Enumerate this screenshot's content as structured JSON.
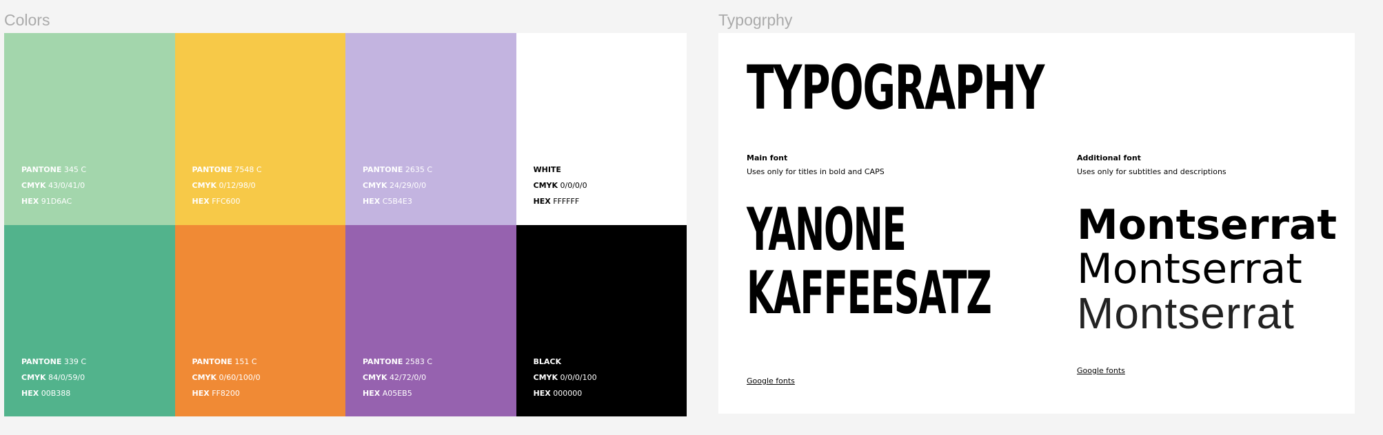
{
  "frames": {
    "colors_label": "Colors",
    "typography_label": "Typogrphy"
  },
  "swatches": [
    {
      "bg": "#A3D6AC",
      "text_color": "#ffffff",
      "name_label": "PANTONE",
      "name_value": "345 C",
      "cmyk_label": "CMYK",
      "cmyk_value": "43/0/41/0",
      "hex_label": "HEX",
      "hex_value": "91D6AC"
    },
    {
      "bg": "#F7C948",
      "text_color": "#ffffff",
      "name_label": "PANTONE",
      "name_value": "7548 C",
      "cmyk_label": "CMYK",
      "cmyk_value": "0/12/98/0",
      "hex_label": "HEX",
      "hex_value": "FFC600"
    },
    {
      "bg": "#C3B4E0",
      "text_color": "#ffffff",
      "name_label": "PANTONE",
      "name_value": "2635 C",
      "cmyk_label": "CMYK",
      "cmyk_value": "24/29/0/0",
      "hex_label": "HEX",
      "hex_value": "C5B4E3"
    },
    {
      "bg": "#FFFFFF",
      "text_color": "#000000",
      "name_label": "WHITE",
      "name_value": "",
      "cmyk_label": "CMYK",
      "cmyk_value": "0/0/0/0",
      "hex_label": "HEX",
      "hex_value": "FFFFFF"
    },
    {
      "bg": "#52B38C",
      "text_color": "#ffffff",
      "name_label": "PANTONE",
      "name_value": "339 C",
      "cmyk_label": "CMYK",
      "cmyk_value": "84/0/59/0",
      "hex_label": "HEX",
      "hex_value": "00B388"
    },
    {
      "bg": "#F08A35",
      "text_color": "#ffffff",
      "name_label": "PANTONE",
      "name_value": "151 C",
      "cmyk_label": "CMYK",
      "cmyk_value": "0/60/100/0",
      "hex_label": "HEX",
      "hex_value": "FF8200"
    },
    {
      "bg": "#9662AF",
      "text_color": "#ffffff",
      "name_label": "PANTONE",
      "name_value": "2583 C",
      "cmyk_label": "CMYK",
      "cmyk_value": "42/72/0/0",
      "hex_label": "HEX",
      "hex_value": "A05EB5"
    },
    {
      "bg": "#000000",
      "text_color": "#ffffff",
      "name_label": "BLACK",
      "name_value": "",
      "cmyk_label": "CMYK",
      "cmyk_value": "0/0/0/100",
      "hex_label": "HEX",
      "hex_value": "000000"
    }
  ],
  "typography": {
    "title": "TYPOGRAPHY",
    "main_font": {
      "heading": "Main font",
      "description": "Uses only for titles in bold and CAPS",
      "sample_line1": "YANONE",
      "sample_line2": "KAFFEESATZ",
      "link": "Google fonts"
    },
    "additional_font": {
      "heading": "Additional font",
      "description": "Uses only for subtitles and descriptions",
      "sample_bold": "Montserrat",
      "sample_regular": "Montserrat",
      "sample_light": "Montserrat",
      "link": "Google fonts"
    }
  }
}
